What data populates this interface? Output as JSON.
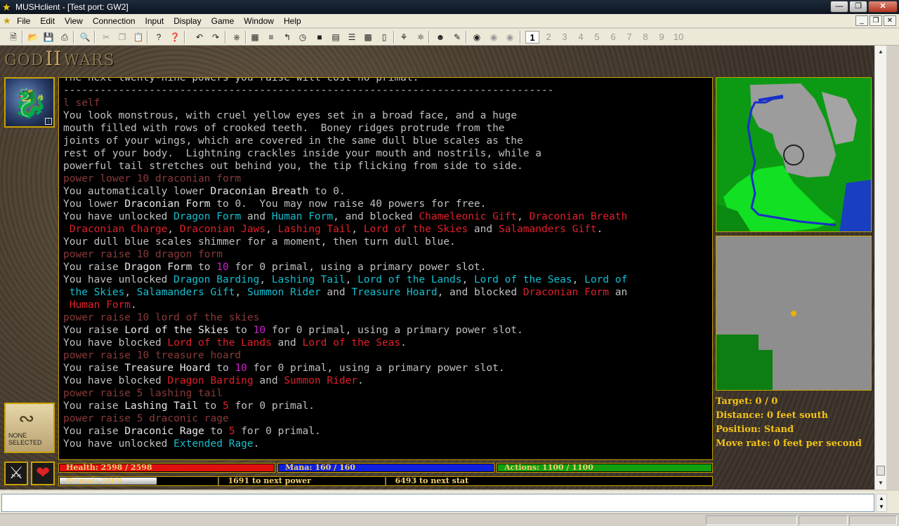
{
  "window": {
    "title": "MUSHclient - [Test port: GW2]"
  },
  "menus": [
    "File",
    "Edit",
    "View",
    "Connection",
    "Input",
    "Display",
    "Game",
    "Window",
    "Help"
  ],
  "toolbar": {
    "worlds": [
      "1",
      "2",
      "3",
      "4",
      "5",
      "6",
      "7",
      "8",
      "9",
      "10"
    ]
  },
  "logo": {
    "left": "GOD",
    "mid": "II",
    "right": "WARS"
  },
  "target_box": {
    "label_line1": "NONE",
    "label_line2": "SELECTED"
  },
  "output_lines": [
    [
      {
        "t": "The next twenty-nine powers you raise will cost no primal.",
        "c": ""
      }
    ],
    [
      {
        "t": "--------------------------------------------------------------------------------",
        "c": ""
      }
    ],
    [
      {
        "t": "l self",
        "c": "c-cmd"
      }
    ],
    [
      {
        "t": "You look monstrous, with cruel yellow eyes set in a broad face, and a huge",
        "c": ""
      }
    ],
    [
      {
        "t": "mouth filled with rows of crooked teeth.  Boney ridges protrude from the",
        "c": ""
      }
    ],
    [
      {
        "t": "joints of your wings, which are covered in the same dull blue scales as the",
        "c": ""
      }
    ],
    [
      {
        "t": "rest of your body.  Lightning crackles inside your mouth and nostrils, while a",
        "c": ""
      }
    ],
    [
      {
        "t": "powerful tail stretches out behind you, the tip flicking from side to side.",
        "c": ""
      }
    ],
    [
      {
        "t": "power lower 10 draconian form",
        "c": "c-cmd"
      }
    ],
    [
      {
        "t": "You automatically lower ",
        "c": ""
      },
      {
        "t": "Draconian Breath",
        "c": "c-w"
      },
      {
        "t": " to 0.",
        "c": ""
      }
    ],
    [
      {
        "t": "You lower ",
        "c": ""
      },
      {
        "t": "Draconian Form",
        "c": "c-w"
      },
      {
        "t": " to 0.  You may now raise 40 powers for free.",
        "c": ""
      }
    ],
    [
      {
        "t": "You have unlocked ",
        "c": ""
      },
      {
        "t": "Dragon Form",
        "c": "c-cyan"
      },
      {
        "t": " and ",
        "c": ""
      },
      {
        "t": "Human Form",
        "c": "c-cyan"
      },
      {
        "t": ", and blocked ",
        "c": ""
      },
      {
        "t": "Chameleonic Gift",
        "c": "c-red"
      },
      {
        "t": ", ",
        "c": ""
      },
      {
        "t": "Draconian Breath",
        "c": "c-red"
      }
    ],
    [
      {
        "t": " Draconian Charge",
        "c": "c-red"
      },
      {
        "t": ", ",
        "c": ""
      },
      {
        "t": "Draconian Jaws",
        "c": "c-red"
      },
      {
        "t": ", ",
        "c": ""
      },
      {
        "t": "Lashing Tail",
        "c": "c-red"
      },
      {
        "t": ", ",
        "c": ""
      },
      {
        "t": "Lord of the Skies",
        "c": "c-red"
      },
      {
        "t": " and ",
        "c": ""
      },
      {
        "t": "Salamanders Gift",
        "c": "c-red"
      },
      {
        "t": ".",
        "c": ""
      }
    ],
    [
      {
        "t": "Your dull blue scales shimmer for a moment, then turn dull blue.",
        "c": ""
      }
    ],
    [
      {
        "t": "power raise 10 dragon form",
        "c": "c-cmd"
      }
    ],
    [
      {
        "t": "You raise ",
        "c": ""
      },
      {
        "t": "Dragon Form",
        "c": "c-w"
      },
      {
        "t": " to ",
        "c": ""
      },
      {
        "t": "10",
        "c": "c-mag"
      },
      {
        "t": " for 0 primal, using a primary power slot.",
        "c": ""
      }
    ],
    [
      {
        "t": "You have unlocked ",
        "c": ""
      },
      {
        "t": "Dragon Barding",
        "c": "c-cyan"
      },
      {
        "t": ", ",
        "c": ""
      },
      {
        "t": "Lashing Tail",
        "c": "c-cyan"
      },
      {
        "t": ", ",
        "c": ""
      },
      {
        "t": "Lord of the Lands",
        "c": "c-cyan"
      },
      {
        "t": ", ",
        "c": ""
      },
      {
        "t": "Lord of the Seas",
        "c": "c-cyan"
      },
      {
        "t": ", ",
        "c": ""
      },
      {
        "t": "Lord of",
        "c": "c-cyan"
      }
    ],
    [
      {
        "t": " the Skies",
        "c": "c-cyan"
      },
      {
        "t": ", ",
        "c": ""
      },
      {
        "t": "Salamanders Gift",
        "c": "c-cyan"
      },
      {
        "t": ", ",
        "c": ""
      },
      {
        "t": "Summon Rider",
        "c": "c-cyan"
      },
      {
        "t": " and ",
        "c": ""
      },
      {
        "t": "Treasure Hoard",
        "c": "c-cyan"
      },
      {
        "t": ", and blocked ",
        "c": ""
      },
      {
        "t": "Draconian Form",
        "c": "c-red"
      },
      {
        "t": " an",
        "c": ""
      }
    ],
    [
      {
        "t": " Human Form",
        "c": "c-red"
      },
      {
        "t": ".",
        "c": ""
      }
    ],
    [
      {
        "t": "power raise 10 lord of the skies",
        "c": "c-cmd"
      }
    ],
    [
      {
        "t": "You raise ",
        "c": ""
      },
      {
        "t": "Lord of the Skies",
        "c": "c-w"
      },
      {
        "t": " to ",
        "c": ""
      },
      {
        "t": "10",
        "c": "c-mag"
      },
      {
        "t": " for 0 primal, using a primary power slot.",
        "c": ""
      }
    ],
    [
      {
        "t": "You have blocked ",
        "c": ""
      },
      {
        "t": "Lord of the Lands",
        "c": "c-red"
      },
      {
        "t": " and ",
        "c": ""
      },
      {
        "t": "Lord of the Seas",
        "c": "c-red"
      },
      {
        "t": ".",
        "c": ""
      }
    ],
    [
      {
        "t": "power raise 10 treasure hoard",
        "c": "c-cmd"
      }
    ],
    [
      {
        "t": "You raise ",
        "c": ""
      },
      {
        "t": "Treasure Hoard",
        "c": "c-w"
      },
      {
        "t": " to ",
        "c": ""
      },
      {
        "t": "10",
        "c": "c-mag"
      },
      {
        "t": " for 0 primal, using a primary power slot.",
        "c": ""
      }
    ],
    [
      {
        "t": "You have blocked ",
        "c": ""
      },
      {
        "t": "Dragon Barding",
        "c": "c-red"
      },
      {
        "t": " and ",
        "c": ""
      },
      {
        "t": "Summon Rider",
        "c": "c-red"
      },
      {
        "t": ".",
        "c": ""
      }
    ],
    [
      {
        "t": "power raise 5 lashing tail",
        "c": "c-cmd"
      }
    ],
    [
      {
        "t": "You raise ",
        "c": ""
      },
      {
        "t": "Lashing Tail",
        "c": "c-w"
      },
      {
        "t": " to ",
        "c": ""
      },
      {
        "t": "5",
        "c": "c-red"
      },
      {
        "t": " for 0 primal.",
        "c": ""
      }
    ],
    [
      {
        "t": "power raise 5 draconic rage",
        "c": "c-cmd"
      }
    ],
    [
      {
        "t": "You raise ",
        "c": ""
      },
      {
        "t": "Draconic Rage",
        "c": "c-w"
      },
      {
        "t": " to ",
        "c": ""
      },
      {
        "t": "5",
        "c": "c-red"
      },
      {
        "t": " for 0 primal.",
        "c": ""
      }
    ],
    [
      {
        "t": "You have unlocked ",
        "c": ""
      },
      {
        "t": "Extended Rage",
        "c": "c-cyan"
      },
      {
        "t": ".",
        "c": ""
      }
    ]
  ],
  "status": {
    "health": {
      "label": "Health: 2598 / 2598",
      "fraction": 1.0,
      "color": "#e01010"
    },
    "mana": {
      "label": "Mana: 160 / 160",
      "fraction": 1.0,
      "color": "#1020e0"
    },
    "actions": {
      "label": "Actions: 1100 / 1100",
      "fraction": 1.0,
      "color": "#10a010"
    },
    "primal": {
      "label": "Primal: 2809"
    },
    "next_power": "1691 to next power",
    "next_stat": "6493 to next stat"
  },
  "info": {
    "target": "Target: 0 / 0",
    "distance": "Distance: 0 feet south",
    "position": "Position: Stand",
    "move_rate": "Move rate: 0 feet per second"
  },
  "colors": {
    "accent": "#c9a100",
    "info_text": "#f3c316"
  }
}
